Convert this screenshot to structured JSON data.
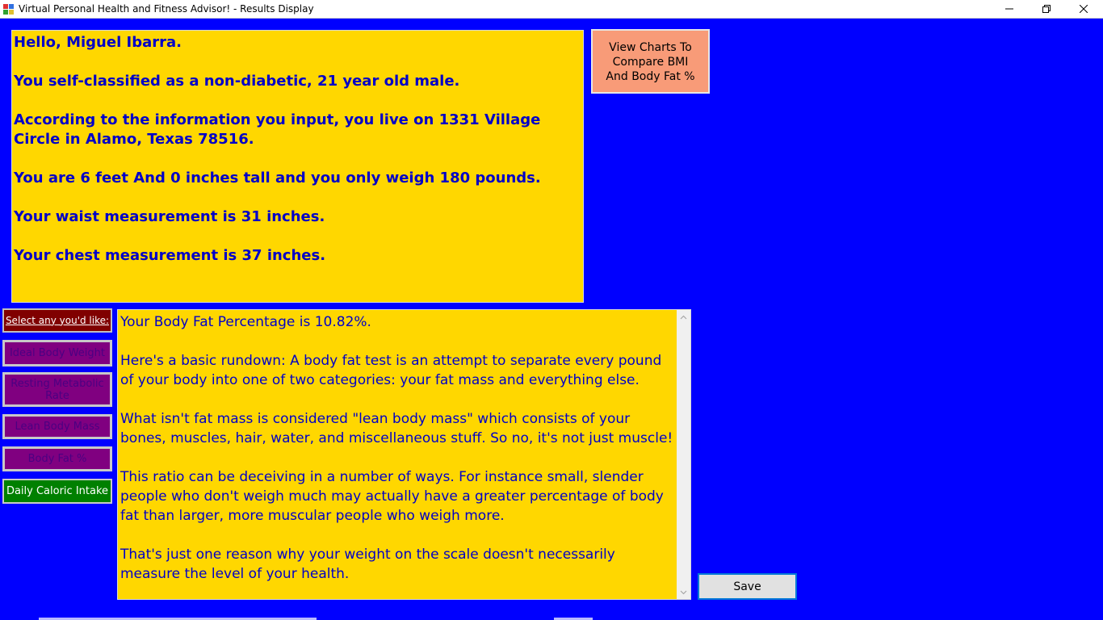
{
  "window": {
    "title": "Virtual Personal Health and Fitness Advisor! - Results Display",
    "icon": "app-icon",
    "controls": [
      "minimize-icon",
      "maximize-icon",
      "close-icon"
    ]
  },
  "info": {
    "greeting": "Hello, Miguel Ibarra.",
    "classification": "You self-classified as a non-diabetic, 21 year old male.",
    "address": "According to the information you input, you live on 1331 Village Circle in Alamo, Texas 78516.",
    "height_weight": "You are 6 feet And 0 inches tall and you only weigh 180 pounds.",
    "waist": "Your waist measurement is 31 inches.",
    "chest": "Your chest measurement is 37 inches."
  },
  "charts_button": {
    "line1": "View Charts To",
    "line2": "Compare BMI",
    "line3": "And Body Fat %"
  },
  "sidebar": {
    "select_label": "Select any you'd like:",
    "ideal_body_weight": "Ideal Body Weight",
    "resting_metabolic_line1": "Resting Metabolic",
    "resting_metabolic_line2": "Rate",
    "lean_body_mass": "Lean Body Mass",
    "body_fat": "Body Fat %",
    "daily_caloric_intake": "Daily Caloric Intake"
  },
  "result": {
    "p1": "Your Body Fat Percentage is 10.82%.",
    "p2": "Here's a basic rundown: A body fat test is an attempt to separate every pound of your body into one of two categories: your fat mass and everything else.",
    "p3": "What isn't fat mass is considered \"lean body mass\" which consists of your bones, muscles, hair, water, and miscellaneous stuff. So no, it's not just muscle!",
    "p4": "This ratio can be deceiving in a number of ways. For instance small, slender people who don't weigh much may actually have a greater percentage of body fat than larger, more muscular people who weigh more.",
    "p5": "That's just one reason why your weight on the scale doesn't necessarily measure the level of your health."
  },
  "save_button": "Save",
  "colors": {
    "background": "#0000ff",
    "panel": "#ffd700",
    "panel_text": "#0000c8",
    "charts_button": "#f89b78",
    "select_label_bg": "#800000",
    "purple_button": "#800080",
    "green_button": "#008000"
  }
}
